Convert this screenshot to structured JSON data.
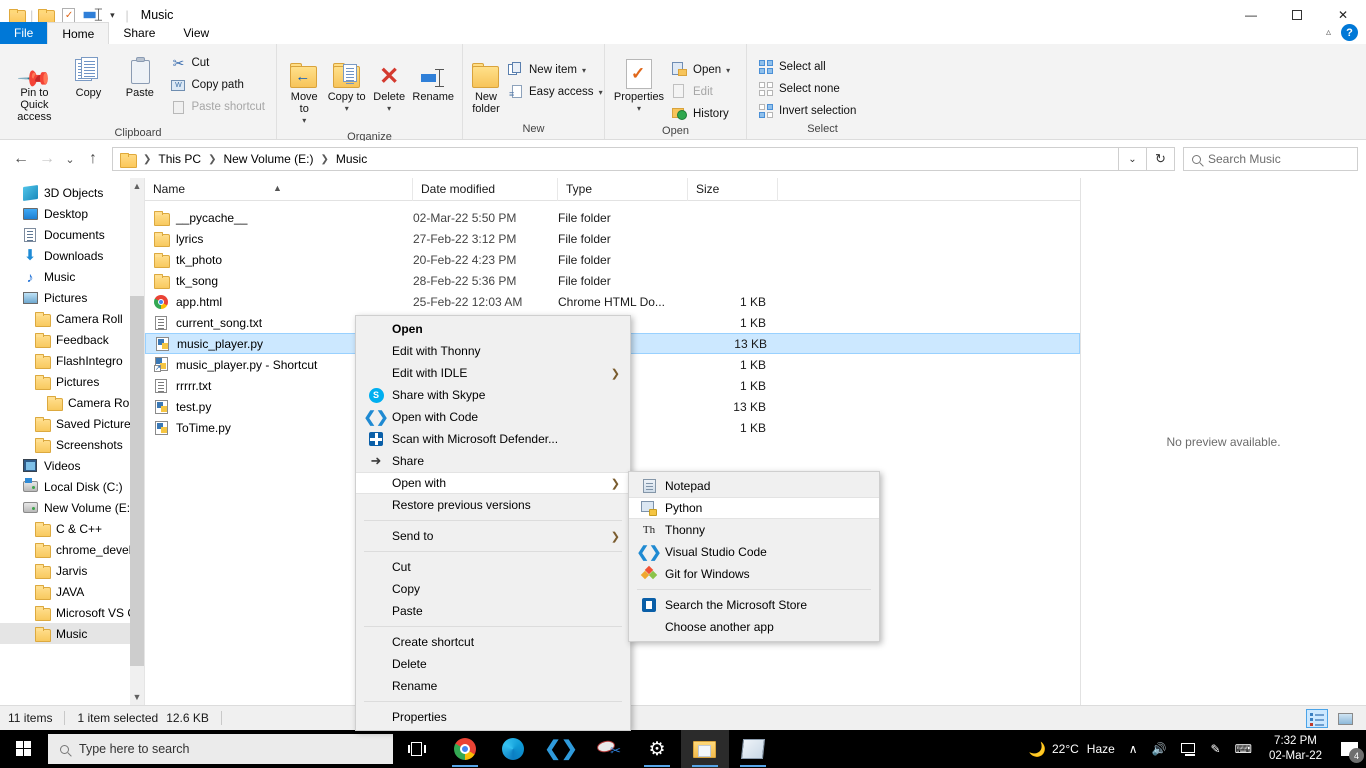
{
  "window": {
    "title": "Music",
    "quick_access_icons": [
      "folder-icon",
      "properties-icon",
      "rename-icon",
      "customize-caret"
    ],
    "controls": {
      "minimize": "—",
      "maximize": "❐",
      "close": "✕"
    },
    "help": "?"
  },
  "tabs": [
    {
      "label": "File",
      "kind": "file"
    },
    {
      "label": "Home",
      "kind": "active"
    },
    {
      "label": "Share",
      "kind": "normal"
    },
    {
      "label": "View",
      "kind": "normal"
    }
  ],
  "ribbon": {
    "groups": [
      {
        "name": "Clipboard",
        "label": "Clipboard",
        "big": [
          {
            "label": "Pin to Quick access",
            "icon": "pin-icon",
            "disabled": false
          },
          {
            "label": "Copy",
            "icon": "copy-icon",
            "disabled": false
          },
          {
            "label": "Paste",
            "icon": "paste-icon",
            "disabled": false
          }
        ],
        "small": [
          {
            "label": "Cut",
            "icon": "scissors-icon",
            "disabled": false
          },
          {
            "label": "Copy path",
            "icon": "copy-path-icon",
            "disabled": false
          },
          {
            "label": "Paste shortcut",
            "icon": "paste-shortcut-icon",
            "disabled": true
          }
        ]
      },
      {
        "name": "Organize",
        "label": "Organize",
        "big": [
          {
            "label": "Move to",
            "icon": "move-to-icon",
            "caret": true
          },
          {
            "label": "Copy to",
            "icon": "copy-to-icon",
            "caret": true
          },
          {
            "label": "Delete",
            "icon": "delete-icon",
            "caret": true
          },
          {
            "label": "Rename",
            "icon": "rename-icon",
            "caret": false
          }
        ]
      },
      {
        "name": "New",
        "label": "New",
        "big": [
          {
            "label": "New folder",
            "icon": "new-folder-icon"
          }
        ],
        "small": [
          {
            "label": "New item",
            "icon": "new-item-icon",
            "caret": true
          },
          {
            "label": "Easy access",
            "icon": "easy-access-icon",
            "caret": true
          }
        ]
      },
      {
        "name": "Open",
        "label": "Open",
        "big": [
          {
            "label": "Properties",
            "icon": "properties-icon",
            "caret": true
          }
        ],
        "small": [
          {
            "label": "Open",
            "icon": "open-icon",
            "caret": true,
            "disabled": false
          },
          {
            "label": "Edit",
            "icon": "edit-icon",
            "disabled": true
          },
          {
            "label": "History",
            "icon": "history-icon",
            "disabled": false
          }
        ]
      },
      {
        "name": "Select",
        "label": "Select",
        "small": [
          {
            "label": "Select all",
            "icon": "select-all-icon"
          },
          {
            "label": "Select none",
            "icon": "select-none-icon"
          },
          {
            "label": "Invert selection",
            "icon": "invert-selection-icon"
          }
        ]
      }
    ]
  },
  "address": {
    "back_icon": "←",
    "forward_icon": "→",
    "recent_icon": "⌄",
    "up_icon": "↑",
    "crumbs": [
      "This PC",
      "New Volume (E:)",
      "Music"
    ],
    "dropdown_icon": "⌄",
    "refresh_icon": "↻"
  },
  "search": {
    "placeholder": "Search Music",
    "icon": "search-icon"
  },
  "navpane": {
    "items": [
      {
        "label": "3D Objects",
        "icon": "3d-objects-icon",
        "indent": 1,
        "selected": false
      },
      {
        "label": "Desktop",
        "icon": "desktop-icon",
        "indent": 1,
        "selected": false
      },
      {
        "label": "Documents",
        "icon": "documents-icon",
        "indent": 1,
        "selected": false
      },
      {
        "label": "Downloads",
        "icon": "downloads-icon",
        "indent": 1,
        "selected": false
      },
      {
        "label": "Music",
        "icon": "music-icon",
        "indent": 1,
        "selected": false
      },
      {
        "label": "Pictures",
        "icon": "pictures-icon",
        "indent": 1,
        "selected": false
      },
      {
        "label": "Camera Roll",
        "icon": "folder-icon",
        "indent": 2,
        "selected": false
      },
      {
        "label": "Feedback",
        "icon": "folder-icon",
        "indent": 2,
        "selected": false
      },
      {
        "label": "FlashIntegro",
        "icon": "folder-icon",
        "indent": 2,
        "selected": false
      },
      {
        "label": "Pictures",
        "icon": "folder-icon",
        "indent": 2,
        "selected": false
      },
      {
        "label": "Camera Roll",
        "icon": "folder-icon",
        "indent": 3,
        "selected": false
      },
      {
        "label": "Saved Pictures",
        "icon": "folder-icon",
        "indent": 2,
        "selected": false
      },
      {
        "label": "Screenshots",
        "icon": "folder-icon",
        "indent": 2,
        "selected": false
      },
      {
        "label": "Videos",
        "icon": "videos-icon",
        "indent": 1,
        "selected": false
      },
      {
        "label": "Local Disk (C:)",
        "icon": "local-disk-icon",
        "indent": 1,
        "selected": false
      },
      {
        "label": "New Volume (E:)",
        "icon": "drive-icon",
        "indent": 1,
        "selected": false
      },
      {
        "label": "C & C++",
        "icon": "folder-icon",
        "indent": 2,
        "selected": false
      },
      {
        "label": "chrome_develo",
        "icon": "folder-icon",
        "indent": 2,
        "selected": false
      },
      {
        "label": "Jarvis",
        "icon": "folder-icon",
        "indent": 2,
        "selected": false
      },
      {
        "label": "JAVA",
        "icon": "folder-icon",
        "indent": 2,
        "selected": false
      },
      {
        "label": "Microsoft VS Co",
        "icon": "folder-icon",
        "indent": 2,
        "selected": false
      },
      {
        "label": "Music",
        "icon": "folder-icon",
        "indent": 2,
        "selected": true
      }
    ]
  },
  "filelist": {
    "columns": [
      "Name",
      "Date modified",
      "Type",
      "Size"
    ],
    "rows": [
      {
        "name": "__pycache__",
        "icon": "folder-icon",
        "date": "02-Mar-22 5:50 PM",
        "type": "File folder",
        "size": "",
        "selected": false
      },
      {
        "name": "lyrics",
        "icon": "folder-icon",
        "date": "27-Feb-22 3:12 PM",
        "type": "File folder",
        "size": "",
        "selected": false
      },
      {
        "name": "tk_photo",
        "icon": "folder-icon",
        "date": "20-Feb-22 4:23 PM",
        "type": "File folder",
        "size": "",
        "selected": false
      },
      {
        "name": "tk_song",
        "icon": "folder-icon",
        "date": "28-Feb-22 5:36 PM",
        "type": "File folder",
        "size": "",
        "selected": false
      },
      {
        "name": "app.html",
        "icon": "chrome-html-icon",
        "date": "25-Feb-22 12:03 AM",
        "type": "Chrome HTML Do...",
        "size": "1 KB",
        "selected": false
      },
      {
        "name": "current_song.txt",
        "icon": "text-file-icon",
        "date": "",
        "type": "ument",
        "size": "1 KB",
        "selected": false
      },
      {
        "name": "music_player.py",
        "icon": "python-file-icon",
        "date": "",
        "type": "ile",
        "size": "13 KB",
        "selected": true
      },
      {
        "name": "music_player.py - Shortcut",
        "icon": "python-shortcut-icon",
        "date": "",
        "type": "",
        "size": "1 KB",
        "selected": false
      },
      {
        "name": "rrrrr.txt",
        "icon": "text-file-icon",
        "date": "",
        "type": "ument",
        "size": "1 KB",
        "selected": false
      },
      {
        "name": "test.py",
        "icon": "python-file-icon",
        "date": "",
        "type": "ile",
        "size": "13 KB",
        "selected": false
      },
      {
        "name": "ToTime.py",
        "icon": "python-file-icon",
        "date": "",
        "type": "ile",
        "size": "1 KB",
        "selected": false
      }
    ]
  },
  "preview": {
    "text": "No preview available."
  },
  "statusbar": {
    "item_count": "11 items",
    "selection": "1 item selected",
    "selection_size": "12.6 KB",
    "view_details_icon": "details-view-icon",
    "view_thumbnails_icon": "thumbnail-view-icon"
  },
  "context_menu": {
    "items": [
      {
        "label": "Open",
        "bold": true,
        "icon": null,
        "arrow": false
      },
      {
        "label": "Edit with Thonny",
        "icon": null,
        "arrow": false
      },
      {
        "label": "Edit with IDLE",
        "icon": null,
        "arrow": true
      },
      {
        "label": "Share with Skype",
        "icon": "skype-icon",
        "arrow": false
      },
      {
        "label": "Open with Code",
        "icon": "vscode-icon",
        "arrow": false
      },
      {
        "label": "Scan with Microsoft Defender...",
        "icon": "defender-icon",
        "arrow": false
      },
      {
        "label": "Share",
        "icon": "share-icon",
        "arrow": false
      },
      {
        "label": "Open with",
        "icon": null,
        "arrow": true,
        "hover": true
      },
      {
        "label": "Restore previous versions",
        "icon": null,
        "arrow": false
      },
      {
        "separator": true
      },
      {
        "label": "Send to",
        "icon": null,
        "arrow": true
      },
      {
        "separator": true
      },
      {
        "label": "Cut",
        "icon": null,
        "arrow": false
      },
      {
        "label": "Copy",
        "icon": null,
        "arrow": false
      },
      {
        "label": "Paste",
        "icon": null,
        "arrow": false
      },
      {
        "separator": true
      },
      {
        "label": "Create shortcut",
        "icon": null,
        "arrow": false
      },
      {
        "label": "Delete",
        "icon": null,
        "arrow": false
      },
      {
        "label": "Rename",
        "icon": null,
        "arrow": false
      },
      {
        "separator": true
      },
      {
        "label": "Properties",
        "icon": null,
        "arrow": false
      }
    ]
  },
  "open_with_submenu": {
    "items": [
      {
        "label": "Notepad",
        "icon": "notepad-icon",
        "hover": false
      },
      {
        "label": "Python",
        "icon": "python-app-icon",
        "hover": true
      },
      {
        "label": "Thonny",
        "icon": "thonny-icon",
        "hover": false
      },
      {
        "label": "Visual Studio Code",
        "icon": "vscode-icon",
        "hover": false
      },
      {
        "label": "Git for Windows",
        "icon": "git-icon",
        "hover": false
      },
      {
        "separator": true
      },
      {
        "label": "Search the Microsoft Store",
        "icon": "store-icon",
        "hover": false
      },
      {
        "label": "Choose another app",
        "icon": null,
        "hover": false
      }
    ]
  },
  "taskbar": {
    "search_placeholder": "Type here to search",
    "apps": [
      {
        "name": "task-view",
        "icon": "task-view-icon",
        "active": false,
        "running": false
      },
      {
        "name": "chrome",
        "icon": "chrome-icon",
        "active": false,
        "running": true
      },
      {
        "name": "edge",
        "icon": "edge-icon",
        "active": false,
        "running": false
      },
      {
        "name": "vscode",
        "icon": "vscode-icon",
        "active": false,
        "running": false
      },
      {
        "name": "snip-sketch",
        "icon": "snip-sketch-icon",
        "active": false,
        "running": false
      },
      {
        "name": "settings",
        "icon": "settings-gear-icon",
        "active": false,
        "running": true
      },
      {
        "name": "file-explorer",
        "icon": "file-explorer-icon",
        "active": true,
        "running": true
      },
      {
        "name": "onenote",
        "icon": "onenote-icon",
        "active": false,
        "running": true
      }
    ],
    "tray": {
      "weather_temp": "22°C",
      "weather_desc": "Haze",
      "weather_icon": "moon-haze-icon",
      "chevron": "∧",
      "volume_icon": "volume-icon",
      "network_icon": "network-icon",
      "pen_icon": "pen-icon",
      "keyboard_icon": "keyboard-icon",
      "time": "7:32 PM",
      "date": "02-Mar-22",
      "notification_count": "4"
    }
  }
}
